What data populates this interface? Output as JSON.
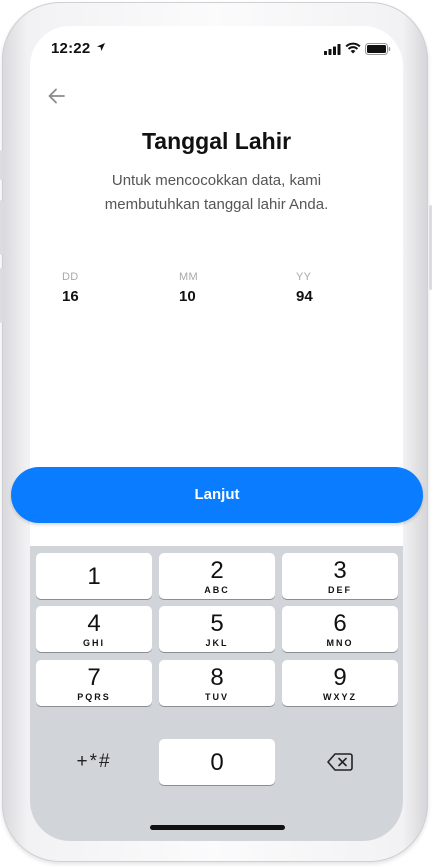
{
  "status_bar": {
    "time": "12:22"
  },
  "header": {
    "title": "Tanggal Lahir",
    "subtitle": "Untuk mencocokkan data, kami membutuhkan tanggal lahir Anda."
  },
  "date_fields": [
    {
      "label": "DD",
      "value": "16"
    },
    {
      "label": "MM",
      "value": "10"
    },
    {
      "label": "YY",
      "value": "94"
    }
  ],
  "continue_button": {
    "label": "Lanjut",
    "color": "#0a7cff"
  },
  "keypad": {
    "keys": [
      {
        "num": "1",
        "letters": ""
      },
      {
        "num": "2",
        "letters": "ABC"
      },
      {
        "num": "3",
        "letters": "DEF"
      },
      {
        "num": "4",
        "letters": "GHI"
      },
      {
        "num": "5",
        "letters": "JKL"
      },
      {
        "num": "6",
        "letters": "MNO"
      },
      {
        "num": "7",
        "letters": "PQRS"
      },
      {
        "num": "8",
        "letters": "TUV"
      },
      {
        "num": "9",
        "letters": "WXYZ"
      },
      {
        "num": "0",
        "letters": ""
      }
    ],
    "symbols": "+*#",
    "backspace_icon": "delete-left-icon"
  }
}
